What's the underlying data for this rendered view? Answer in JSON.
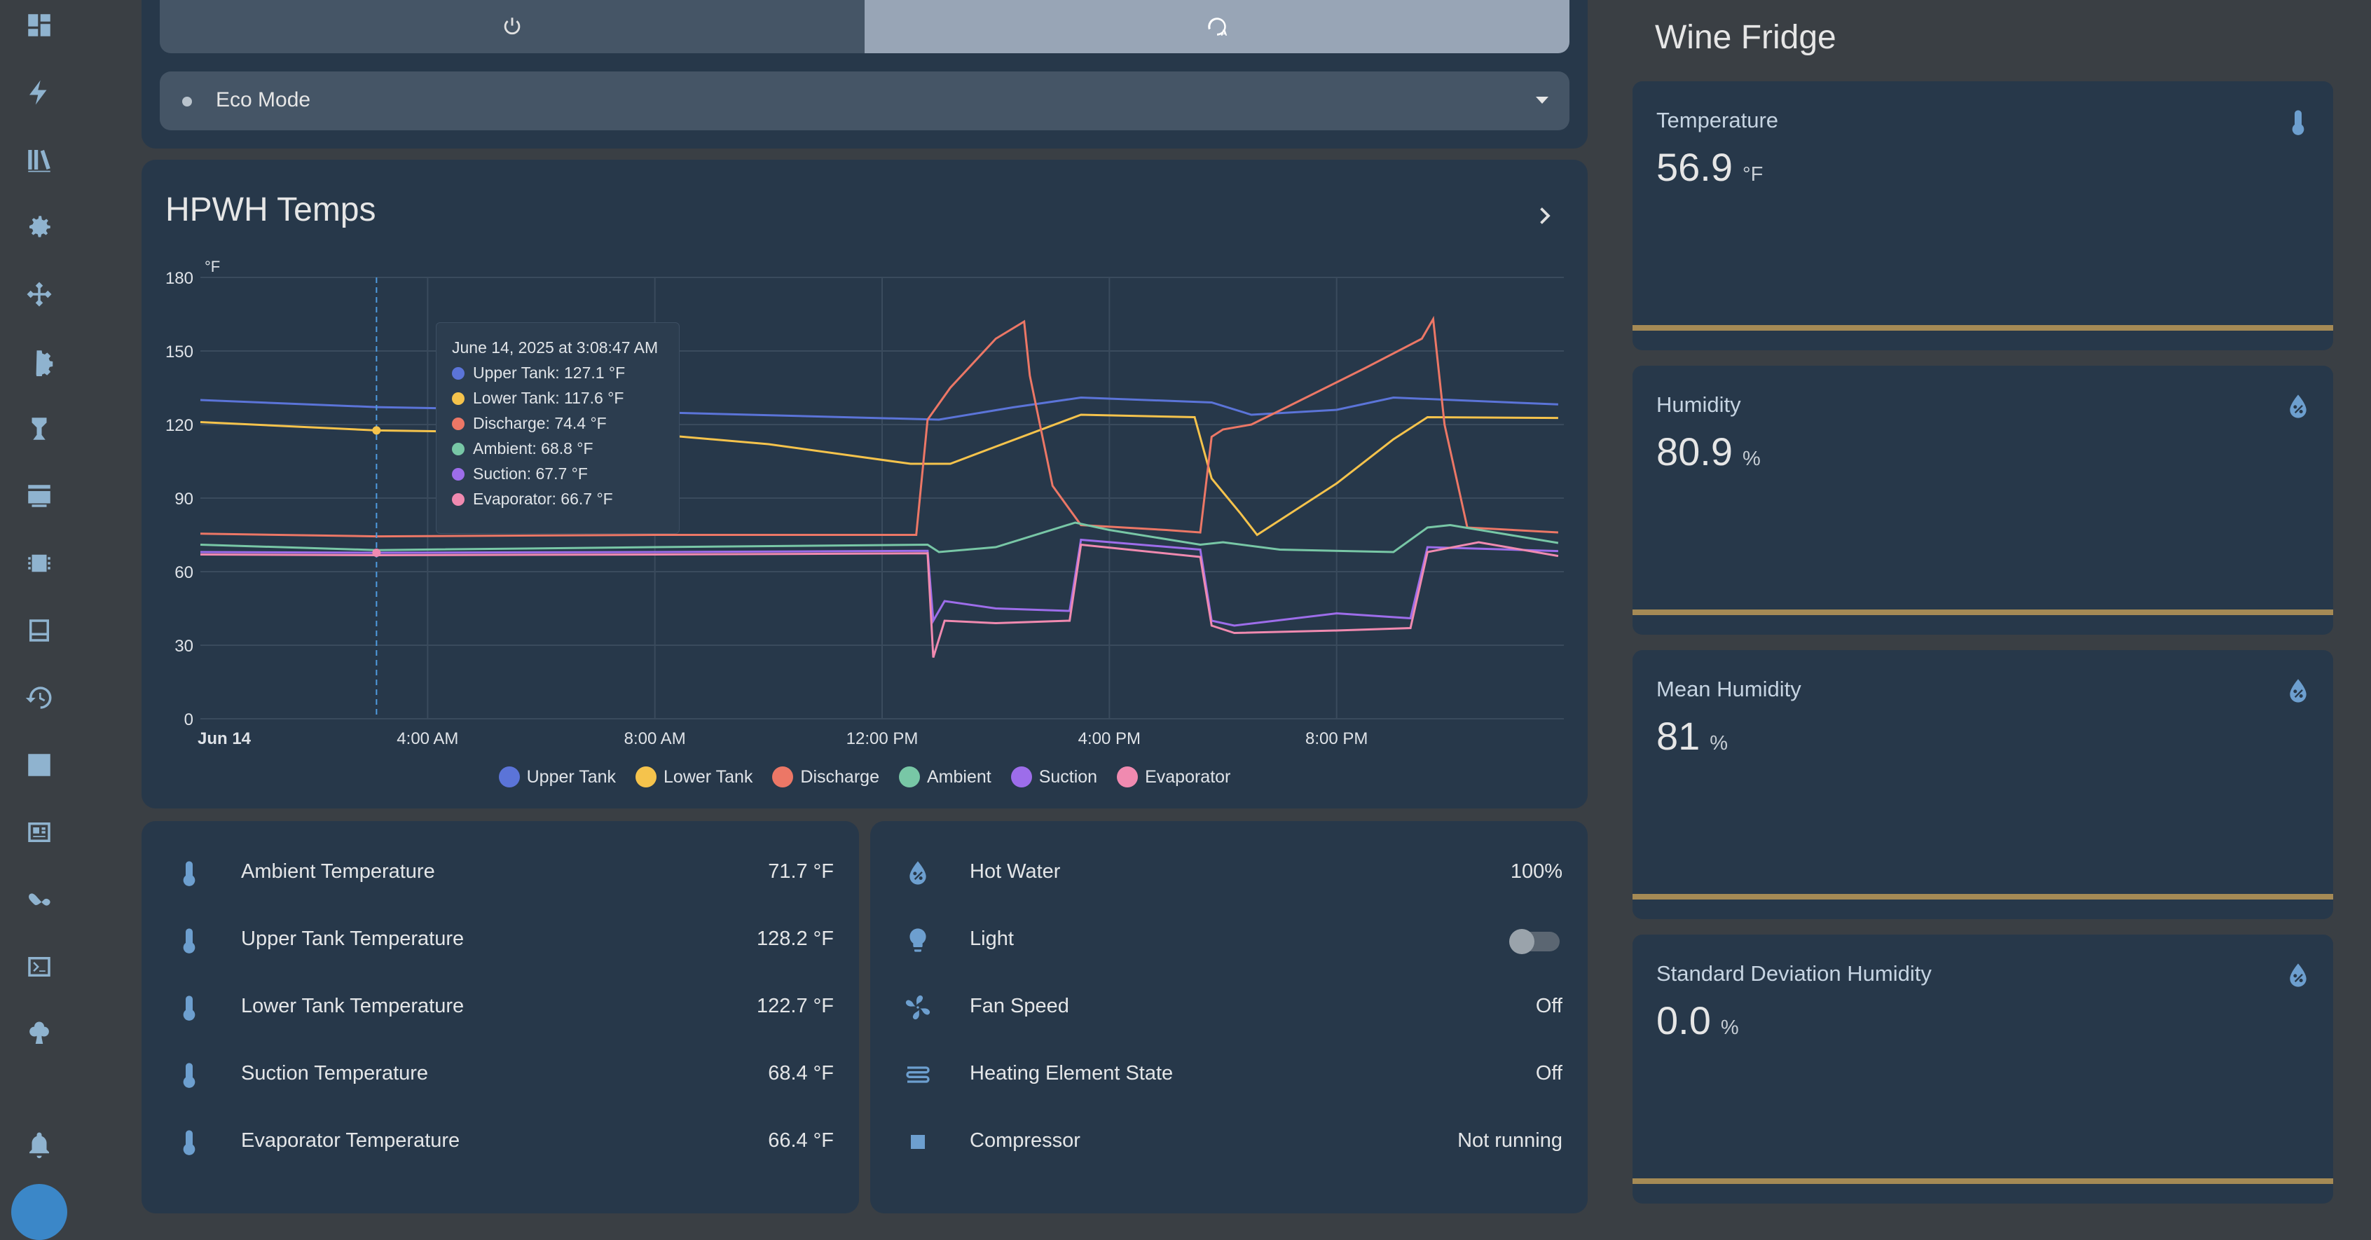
{
  "sidebar": {
    "icons": [
      "dashboard-icon",
      "energy-icon",
      "map-icon",
      "settings-icon",
      "integrations-icon",
      "devices-icon",
      "automations-icon",
      "hacs-icon",
      "chip-icon",
      "panel-icon",
      "history-icon",
      "statistics-icon",
      "logbook-icon",
      "zigbee-icon",
      "terminal-icon",
      "clover-icon",
      "notifications-icon"
    ]
  },
  "top": {
    "mode_select_value": "Eco Mode"
  },
  "chart_card": {
    "title": "HPWH Temps",
    "chart_data": {
      "type": "line",
      "ylabel": "°F",
      "ylim": [
        0,
        180
      ],
      "yticks": [
        0,
        30,
        60,
        90,
        120,
        150,
        180
      ],
      "xlim": [
        "Jun 14 00:00",
        "Jun 14 23:59"
      ],
      "xtick_labels": [
        "Jun 14",
        "4:00 AM",
        "8:00 AM",
        "12:00 PM",
        "4:00 PM",
        "8:00 PM"
      ],
      "xtick_hours": [
        0,
        4,
        8,
        12,
        16,
        20
      ],
      "grid": true,
      "legend_placement": "bottom",
      "series": [
        {
          "name": "Upper Tank",
          "color": "#5b74d8",
          "points": [
            [
              0,
              130
            ],
            [
              3.1,
              127.1
            ],
            [
              8,
              125
            ],
            [
              13,
              122
            ],
            [
              14.3,
              127
            ],
            [
              15.5,
              131
            ],
            [
              17.8,
              129
            ],
            [
              18.5,
              124
            ],
            [
              20,
              126
            ],
            [
              21,
              131
            ],
            [
              23.9,
              128.2
            ]
          ]
        },
        {
          "name": "Lower Tank",
          "color": "#f5c34c",
          "points": [
            [
              0,
              121
            ],
            [
              3.1,
              117.6
            ],
            [
              8,
              116
            ],
            [
              10,
              112
            ],
            [
              12.5,
              104
            ],
            [
              13.2,
              104
            ],
            [
              14,
              111
            ],
            [
              15.5,
              124
            ],
            [
              17.5,
              123
            ],
            [
              17.8,
              98
            ],
            [
              18.3,
              84
            ],
            [
              18.6,
              75
            ],
            [
              20,
              96
            ],
            [
              21,
              114
            ],
            [
              21.6,
              123
            ],
            [
              23.9,
              122.7
            ]
          ]
        },
        {
          "name": "Discharge",
          "color": "#ec7766",
          "points": [
            [
              0,
              75.5
            ],
            [
              3.1,
              74.4
            ],
            [
              8,
              75
            ],
            [
              12.6,
              75
            ],
            [
              12.8,
              122
            ],
            [
              13.2,
              135
            ],
            [
              14,
              155
            ],
            [
              14.5,
              162
            ],
            [
              14.6,
              140
            ],
            [
              15,
              95
            ],
            [
              15.5,
              79
            ],
            [
              17,
              77
            ],
            [
              17.6,
              76
            ],
            [
              17.8,
              115
            ],
            [
              18,
              118
            ],
            [
              18.5,
              120
            ],
            [
              19.2,
              128
            ],
            [
              20.5,
              143
            ],
            [
              21.5,
              155
            ],
            [
              21.7,
              163
            ],
            [
              21.9,
              120
            ],
            [
              22.3,
              78
            ],
            [
              23.9,
              76
            ]
          ]
        },
        {
          "name": "Ambient",
          "color": "#78c7a6",
          "points": [
            [
              0,
              71
            ],
            [
              3.1,
              68.8
            ],
            [
              8,
              70
            ],
            [
              12.8,
              71
            ],
            [
              13,
              68
            ],
            [
              14,
              70
            ],
            [
              15.4,
              80
            ],
            [
              16,
              77
            ],
            [
              17.6,
              71
            ],
            [
              18,
              72
            ],
            [
              19,
              69
            ],
            [
              21,
              68
            ],
            [
              21.6,
              78
            ],
            [
              22,
              79
            ],
            [
              23.9,
              71.7
            ]
          ]
        },
        {
          "name": "Suction",
          "color": "#9d6dea",
          "points": [
            [
              0,
              68
            ],
            [
              3.1,
              67.7
            ],
            [
              8,
              68
            ],
            [
              12.8,
              68.5
            ],
            [
              12.9,
              40
            ],
            [
              13.1,
              48
            ],
            [
              14,
              45
            ],
            [
              15.3,
              44
            ],
            [
              15.5,
              73
            ],
            [
              17.6,
              69
            ],
            [
              17.8,
              40
            ],
            [
              18.2,
              38
            ],
            [
              20,
              43
            ],
            [
              21.3,
              41
            ],
            [
              21.6,
              70
            ],
            [
              23.9,
              68.4
            ]
          ]
        },
        {
          "name": "Evaporator",
          "color": "#f08ab0",
          "points": [
            [
              0,
              67
            ],
            [
              3.1,
              66.7
            ],
            [
              8,
              67
            ],
            [
              12.8,
              67.5
            ],
            [
              12.9,
              25
            ],
            [
              13.1,
              40
            ],
            [
              14,
              39
            ],
            [
              15.3,
              40
            ],
            [
              15.5,
              71
            ],
            [
              17.6,
              66
            ],
            [
              17.8,
              38
            ],
            [
              18.2,
              35
            ],
            [
              20,
              36
            ],
            [
              21.3,
              37
            ],
            [
              21.6,
              68
            ],
            [
              22.5,
              72
            ],
            [
              23.9,
              66.4
            ]
          ]
        }
      ],
      "tooltip": {
        "title": "June 14, 2025 at 3:08:47 AM",
        "hour": 3.1,
        "rows": [
          "Upper Tank: 127.1 °F",
          "Lower Tank: 117.6 °F",
          "Discharge: 74.4 °F",
          "Ambient: 68.8 °F",
          "Suction: 67.7 °F",
          "Evaporator: 66.7 °F"
        ]
      }
    }
  },
  "left_entities": [
    {
      "icon": "thermometer-icon",
      "name": "Ambient Temperature",
      "value": "71.7 °F"
    },
    {
      "icon": "thermometer-icon",
      "name": "Upper Tank Temperature",
      "value": "128.2 °F"
    },
    {
      "icon": "thermometer-icon",
      "name": "Lower Tank Temperature",
      "value": "122.7 °F"
    },
    {
      "icon": "thermometer-icon",
      "name": "Suction Temperature",
      "value": "68.4 °F"
    },
    {
      "icon": "thermometer-icon",
      "name": "Evaporator Temperature",
      "value": "66.4 °F"
    }
  ],
  "right_entities": [
    {
      "icon": "water-percent-icon",
      "name": "Hot Water",
      "value": "100%"
    },
    {
      "icon": "lightbulb-icon",
      "name": "Light",
      "value": ""
    },
    {
      "icon": "fan-icon",
      "name": "Fan Speed",
      "value": "Off"
    },
    {
      "icon": "heating-element-icon",
      "name": "Heating Element State",
      "value": "Off"
    },
    {
      "icon": "square-icon",
      "name": "Compressor",
      "value": "Not running"
    }
  ],
  "wine_fridge": {
    "title": "Wine Fridge",
    "cards": [
      {
        "name": "Temperature",
        "value": "56.9",
        "unit": "°F",
        "icon": "thermometer-icon"
      },
      {
        "name": "Humidity",
        "value": "80.9",
        "unit": "%",
        "icon": "water-percent-icon"
      },
      {
        "name": "Mean Humidity",
        "value": "81",
        "unit": "%",
        "icon": "water-percent-icon"
      },
      {
        "name": "Standard Deviation Humidity",
        "value": "0.0",
        "unit": "%",
        "icon": "water-percent-icon"
      }
    ]
  },
  "colors": {
    "accent": "#8fb3cf",
    "card": "#27384a",
    "background": "#3a3f44",
    "bar": "#a58a55"
  }
}
